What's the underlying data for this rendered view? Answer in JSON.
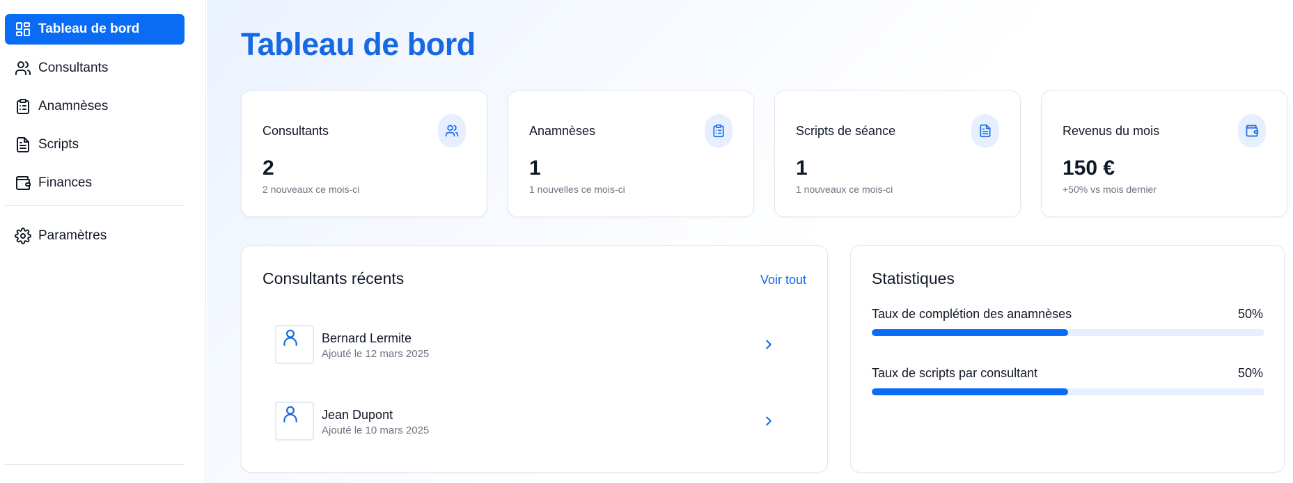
{
  "sidebar": {
    "items": [
      {
        "label": "Tableau de bord",
        "icon": "layout-grid-icon",
        "active": true
      },
      {
        "label": "Consultants",
        "icon": "users-icon",
        "active": false
      },
      {
        "label": "Anamnèses",
        "icon": "clipboard-list-icon",
        "active": false
      },
      {
        "label": "Scripts",
        "icon": "file-text-icon",
        "active": false
      },
      {
        "label": "Finances",
        "icon": "wallet-icon",
        "active": false
      }
    ],
    "settings": {
      "label": "Paramètres",
      "icon": "settings-icon"
    }
  },
  "page": {
    "title": "Tableau de bord"
  },
  "stats": [
    {
      "label": "Consultants",
      "value": "2",
      "sub": "2 nouveaux ce mois-ci",
      "icon": "users-icon"
    },
    {
      "label": "Anamnèses",
      "value": "1",
      "sub": "1 nouvelles ce mois-ci",
      "icon": "clipboard-list-icon"
    },
    {
      "label": "Scripts de séance",
      "value": "1",
      "sub": "1 nouveaux ce mois-ci",
      "icon": "file-text-icon"
    },
    {
      "label": "Revenus du mois",
      "value": "150 €",
      "sub": "+50% vs mois dernier",
      "icon": "wallet-icon"
    }
  ],
  "recent": {
    "title": "Consultants récents",
    "see_all": "Voir tout",
    "items": [
      {
        "name": "Bernard Lermite",
        "date": "Ajouté le 12 mars 2025"
      },
      {
        "name": "Jean Dupont",
        "date": "Ajouté le 10 mars 2025"
      }
    ]
  },
  "statistics": {
    "title": "Statistiques",
    "items": [
      {
        "label": "Taux de complétion des anamnèses",
        "value": "50%",
        "percent": 50
      },
      {
        "label": "Taux de scripts par consultant",
        "value": "50%",
        "percent": 50
      }
    ]
  },
  "colors": {
    "accent": "#0a6cf5",
    "title": "#1668e3",
    "icon_bg": "#e5efff"
  }
}
